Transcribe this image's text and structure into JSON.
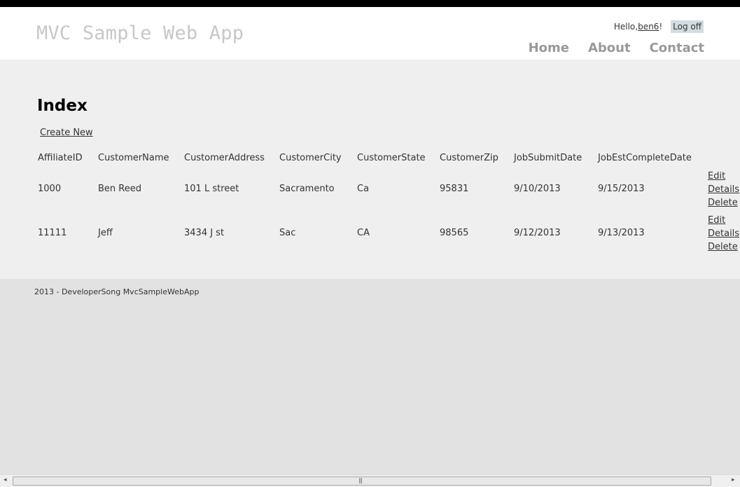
{
  "header": {
    "site_title": "MVC Sample Web App",
    "hello_prefix": "Hello, ",
    "username": "ben6",
    "hello_suffix": "!",
    "log_off": "Log off",
    "nav": [
      "Home",
      "About",
      "Contact"
    ]
  },
  "main": {
    "page_title": "Index",
    "create_new": "Create New",
    "columns": [
      "AffiliateID",
      "CustomerName",
      "CustomerAddress",
      "CustomerCity",
      "CustomerState",
      "CustomerZip",
      "JobSubmitDate",
      "JobEstCompleteDate"
    ],
    "rows": [
      [
        "1000",
        "Ben Reed",
        "101 L street",
        "Sacramento",
        "Ca",
        "95831",
        "9/10/2013",
        "9/15/2013"
      ],
      [
        "11111",
        "Jeff",
        "3434 J st",
        "Sac",
        "CA",
        "98565",
        "9/12/2013",
        "9/13/2013"
      ]
    ],
    "actions": [
      "Edit",
      "Details",
      "Delete"
    ]
  },
  "footer": {
    "text": "2013 - DeveloperSong MvcSampleWebApp"
  },
  "scrollbar": {
    "left_arrow": "◂",
    "right_arrow": "▸",
    "grip": "|||"
  }
}
